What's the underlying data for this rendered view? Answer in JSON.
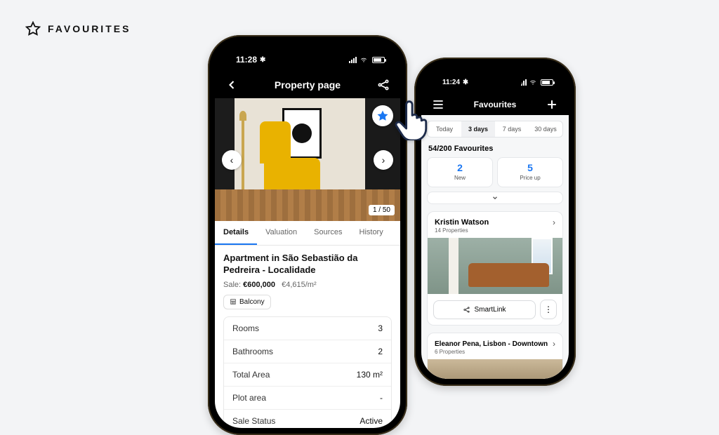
{
  "header": {
    "label": "FAVOURITES"
  },
  "phone1": {
    "status_time": "11:28",
    "nav": {
      "title": "Property page"
    },
    "hero": {
      "counter": "1 / 50"
    },
    "tabs": [
      "Details",
      "Valuation",
      "Sources",
      "History"
    ],
    "active_tab_index": 0,
    "property": {
      "title": "Apartment in São Sebastião da Pedreira - Localidade",
      "sale_label": "Sale:",
      "price": "€600,000",
      "price_sq": "€4,615/m²"
    },
    "feature_chip": "Balcony",
    "specs": [
      {
        "k": "Rooms",
        "v": "3"
      },
      {
        "k": "Bathrooms",
        "v": "2"
      },
      {
        "k": "Total Area",
        "v": "130 m²"
      },
      {
        "k": "Plot area",
        "v": "-"
      },
      {
        "k": "Sale Status",
        "v": "Active"
      }
    ]
  },
  "phone2": {
    "status_time": "11:24",
    "nav": {
      "title": "Favourites"
    },
    "segments": [
      "Today",
      "3 days",
      "7 days",
      "30 days"
    ],
    "active_segment_index": 1,
    "count_label": "54/200 Favourites",
    "stats": [
      {
        "num": "2",
        "lbl": "New"
      },
      {
        "num": "5",
        "lbl": "Price up"
      }
    ],
    "smartlink_label": "SmartLink",
    "cards": [
      {
        "name": "Kristin Watson",
        "sub": "14 Properties"
      },
      {
        "name": "Eleanor Pena, Lisbon - Downtown",
        "sub": "6 Properties"
      }
    ]
  }
}
